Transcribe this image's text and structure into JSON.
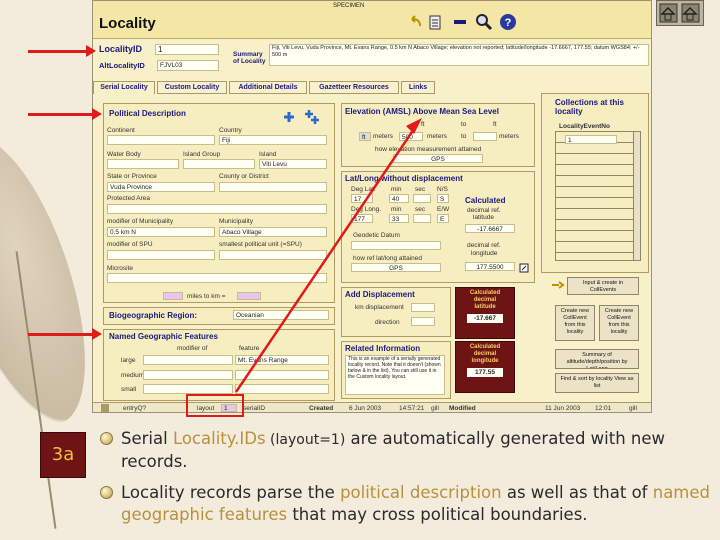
{
  "colors": {
    "accent": "#b8903a",
    "arrow": "#e11a1a",
    "calc_bg": "#6e1414",
    "heading": "#1a1a80"
  },
  "app": {
    "specimen": "SPECIMEN",
    "title": "Locality",
    "id_label": "LocalityID",
    "id_value": "1",
    "alt_id_label": "AltLocalityID",
    "alt_id_value": "FJVL03",
    "summary_label": "Summary of Locality",
    "summary_text": "Fiji, Viti Levu, Vuda Province, Mt. Evans Range, 0.5 km N Abaco Village; elevation not reported; latitude/longitude -17.6667, 177.55; datum WGS84; +/- 500 m",
    "tabs": [
      "Serial Locality",
      "Custom Locality",
      "Additional Details",
      "Gazetteer Resources",
      "Links"
    ],
    "political": {
      "title": "Political Description",
      "continent_label": "Continent",
      "continent": "",
      "country_label": "Country",
      "country": "Fiji",
      "water_label": "Water Body",
      "water": "",
      "island_group_label": "Island Group",
      "island_group": "",
      "island_label": "Island",
      "island": "Viti Levu",
      "state_label": "State or Province",
      "state": "Vuda Province",
      "county_label": "County or District",
      "county": "",
      "protected_label": "Protected Area",
      "protected": "",
      "mod_muni_label": "modifier of Municipality",
      "mod_muni": "0.5 km N",
      "muni_label": "Municipality",
      "muni": "Abaco Village",
      "mod_spu_label": "modifier of SPU",
      "mod_spu": "",
      "spu_label": "smallest political unit (=SPU)",
      "spu": "",
      "micro_label": "Microsite",
      "micro": "",
      "miles_label": "miles to km =",
      "miles": ""
    },
    "bio": {
      "label": "Biogeographic Region:",
      "value": "Oceanian"
    },
    "named": {
      "title": "Named Geographic Features",
      "modifier_label": "modifier of",
      "feature_label": "feature",
      "large_label": "large",
      "large_value": "Mt. Evans Range",
      "medium_label": "medium",
      "small_label": "small"
    },
    "elevation": {
      "title": "Elevation (AMSL) Above Mean Sea Level",
      "ft_label": "ft",
      "to_label": "to",
      "ft2_label": "ft",
      "ft_sel": "ft",
      "meters_label": "meters",
      "meters2_label": "meters",
      "value": "500",
      "to_value": "",
      "method_label": "how elevation measurement attained",
      "method": "GPS"
    },
    "latlong": {
      "title": "Lat/Long without displacement",
      "deg_lat": "Deg Lat.",
      "min": "min",
      "sec": "sec",
      "ns": "N/S",
      "deg_lat_v": "17",
      "min_v": "40",
      "sec_v": "",
      "ns_v": "S",
      "deg_long": "Deg Long.",
      "min2": "min",
      "sec2": "sec",
      "ew": "E/W",
      "deg_long_v": "177",
      "min2_v": "33",
      "sec2_v": "",
      "ew_v": "E",
      "calc_title": "Calculated",
      "dec_ref": "decimal ref.",
      "lat_label": "latitude",
      "lat_v": "-17.6667",
      "datum_label": "Geodetic Datum",
      "datum": "",
      "dec_ref2": "decimal ref.",
      "long_label": "longitude",
      "long_v": "177.5500",
      "how_label": "how ref lat/long attained",
      "how": "GPS"
    },
    "displacement": {
      "title": "Add Displacement",
      "km_label": "km displacement",
      "km": "",
      "dir_label": "direction",
      "dir": ""
    },
    "calc1": {
      "label": "Calculated decimal latitude",
      "value": "-17.667"
    },
    "calc2": {
      "label": "Calculated decimal longitude",
      "value": "177.55"
    },
    "related": {
      "title": "Related Information",
      "text": "This is an example of a serially generated locality record. Note that it doesn't (shown below & in the list). You can still use it in the Custom locality layout."
    },
    "collections": {
      "title": "Collections at this locality",
      "col_header": "LocalityEventNo",
      "row1": "1"
    },
    "side_buttons": {
      "b1": "Input & create in CollEvents",
      "b2": "Create new CollEvent from this locality",
      "b3": "Create new CollEvent from this locality",
      "b4": "Summary of altitude/depth/position by Lat/Long",
      "b5": "Find & sort by locality View as list"
    },
    "status": {
      "entry_label": "entryQ?",
      "layout_label": "layout",
      "layout_value": "1",
      "serial_label": "serialID",
      "created_label": "Created",
      "created_date": "6 Jun 2003",
      "created_time": "14:57:21",
      "created_by": "gill",
      "modified_label": "Modified",
      "modified_date": "11 Jun 2003",
      "modified_time": "12:01",
      "modified_by": "gill"
    }
  },
  "slide": {
    "number": "3a",
    "b1_pre": "Serial ",
    "b1_hl": "Locality.IDs",
    "b1_mid": " (layout=1)",
    "b1_post": " are automatically generated with new records.",
    "b2_pre": "Locality records parse the ",
    "b2_hl1": "political description",
    "b2_mid": " as well as that of ",
    "b2_hl2": "named geographic features",
    "b2_post": " that may cross political boundaries."
  }
}
